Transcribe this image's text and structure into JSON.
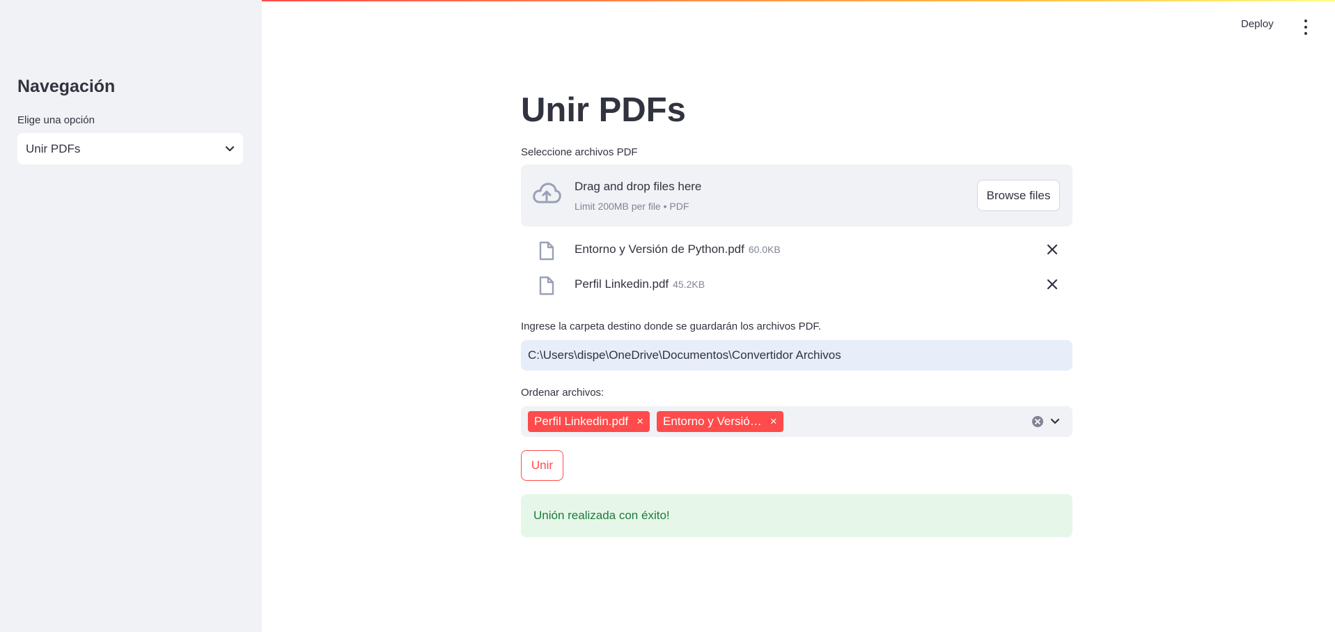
{
  "sidebar": {
    "title": "Navegación",
    "select_label": "Elige una opción",
    "select_value": "Unir PDFs"
  },
  "header": {
    "deploy_label": "Deploy"
  },
  "main": {
    "title": "Unir PDFs",
    "uploader": {
      "label": "Seleccione archivos PDF",
      "drop_text": "Drag and drop files here",
      "limit_text": "Limit 200MB per file • PDF",
      "browse_label": "Browse files",
      "files": [
        {
          "name": "Entorno y Versión de Python.pdf",
          "size": "60.0KB"
        },
        {
          "name": "Perfil Linkedin.pdf",
          "size": "45.2KB"
        }
      ]
    },
    "folder": {
      "label": "Ingrese la carpeta destino donde se guardarán los archivos PDF.",
      "value": "C:\\Users\\dispe\\OneDrive\\Documentos\\Convertidor Archivos"
    },
    "order": {
      "label": "Ordenar archivos:",
      "tags": [
        "Perfil Linkedin.pdf",
        "Entorno y Versió…"
      ],
      "tag_remove_symbol": "×"
    },
    "submit_label": "Unir",
    "success_message": "Unión realizada con éxito!"
  },
  "colors": {
    "accent": "#ff4b4b",
    "sidebar_bg": "#f0f2f6",
    "success_bg": "#e6f7ea",
    "success_text": "#1c7a37",
    "input_bg": "#e8eef9"
  },
  "icons": [
    "chevron-down-icon",
    "more-vert-icon",
    "cloud-upload-icon",
    "file-icon",
    "close-icon",
    "clear-circle-icon"
  ]
}
